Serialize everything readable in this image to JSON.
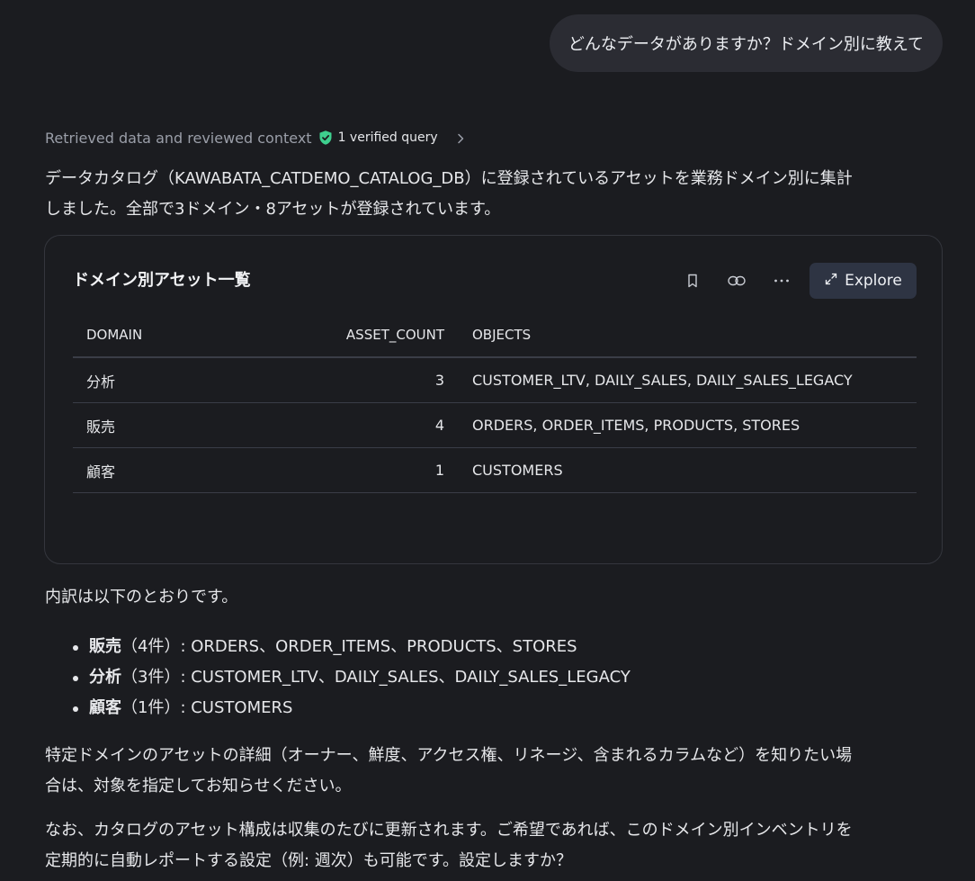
{
  "user_message": "どんなデータがありますか？ドメイン別に教えて",
  "status": {
    "text": "Retrieved data and reviewed context",
    "verified_label": "1 verified query"
  },
  "intro_line1": "データカタログ（KAWABATA_CATDEMO_CATALOG_DB）に登録されているアセットを業務ドメイン別に集計",
  "intro_line2": "しました。全部で3ドメイン・8アセットが登録されています。",
  "card": {
    "title": "ドメイン別アセット一覧",
    "explore_label": "Explore",
    "columns": [
      "DOMAIN",
      "ASSET_COUNT",
      "OBJECTS"
    ],
    "rows": [
      {
        "domain": "分析",
        "asset_count": "3",
        "objects": "CUSTOMER_LTV, DAILY_SALES, DAILY_SALES_LEGACY"
      },
      {
        "domain": "販売",
        "asset_count": "4",
        "objects": "ORDERS, ORDER_ITEMS, PRODUCTS, STORES"
      },
      {
        "domain": "顧客",
        "asset_count": "1",
        "objects": "CUSTOMERS"
      }
    ]
  },
  "breakdown_intro": "内訳は以下のとおりです。",
  "breakdown": [
    {
      "domain": "販売",
      "rest": "（4件）: ORDERS、ORDER_ITEMS、PRODUCTS、STORES"
    },
    {
      "domain": "分析",
      "rest": "（3件）: CUSTOMER_LTV、DAILY_SALES、DAILY_SALES_LEGACY"
    },
    {
      "domain": "顧客",
      "rest": "（1件）: CUSTOMERS"
    }
  ],
  "detail_line1": "特定ドメインのアセットの詳細（オーナー、鮮度、アクセス権、リネージ、含まれるカラムなど）を知りたい場",
  "detail_line2": "合は、対象を指定してお知らせください。",
  "note_line1": "なお、カタログのアセット構成は収集のたびに更新されます。ご希望であれば、このドメイン別インベントリを",
  "note_line2": "定期的に自動レポートする設定（例: 週次）も可能です。設定しますか？",
  "colors": {
    "background": "#1b1c20",
    "bubble": "#2b2c33",
    "verified_shield": "#3ecf8e",
    "explore_button": "#2e3443"
  }
}
